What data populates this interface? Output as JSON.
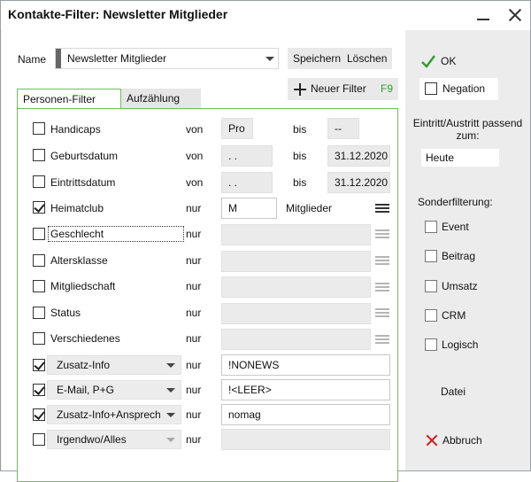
{
  "window": {
    "title": "Kontakte-Filter: Newsletter Mitglieder"
  },
  "header": {
    "name_label": "Name",
    "name_value": "Newsletter Mitglieder",
    "save_label": "Speichern",
    "delete_label": "Löschen",
    "new_filter_label": "Neuer Filter",
    "new_filter_shortcut": "F9"
  },
  "tabs": [
    {
      "label": "Personen-Filter",
      "active": true
    },
    {
      "label": "Aufzählung",
      "active": false
    }
  ],
  "rows": [
    {
      "label": "Handicaps",
      "checked": false,
      "op": "von",
      "from": "Pro",
      "to_label": "bis",
      "to": "--"
    },
    {
      "label": "Geburtsdatum",
      "checked": false,
      "op": "von",
      "from": " .  .",
      "to_label": "bis",
      "to": "31.12.2020"
    },
    {
      "label": "Eintrittsdatum",
      "checked": false,
      "op": "von",
      "from": " .  .",
      "to_label": "bis",
      "to": "31.12.2020"
    },
    {
      "label": "Heimatclub",
      "checked": true,
      "op": "nur",
      "value": "M",
      "suffix": "Mitglieder"
    },
    {
      "label": "Geschlecht",
      "checked": false,
      "op": "nur",
      "value": ""
    },
    {
      "label": "Altersklasse",
      "checked": false,
      "op": "nur",
      "value": ""
    },
    {
      "label": "Mitgliedschaft",
      "checked": false,
      "op": "nur",
      "value": ""
    },
    {
      "label": "Status",
      "checked": false,
      "op": "nur",
      "value": ""
    },
    {
      "label": "Verschiedenes",
      "checked": false,
      "op": "nur",
      "value": ""
    },
    {
      "label": "Zusatz-Info",
      "checked": true,
      "op": "nur",
      "value": "!NONEWS"
    },
    {
      "label": "E-Mail, P+G",
      "checked": true,
      "op": "nur",
      "value": "!<LEER>"
    },
    {
      "label": "Zusatz-Info+Ansprech",
      "checked": true,
      "op": "nur",
      "value": "nomag"
    },
    {
      "label": "Irgendwo/Alles",
      "checked": false,
      "op": "nur",
      "value": ""
    }
  ],
  "side": {
    "ok_label": "OK",
    "negation_label": "Negation",
    "entry_exit_label": "Eintritt/Austritt passend zum:",
    "entry_exit_value": "Heute",
    "special_label": "Sonderfilterung:",
    "special_items": [
      "Event",
      "Beitrag",
      "Umsatz",
      "CRM",
      "Logisch"
    ],
    "file_label": "Datei",
    "cancel_label": "Abbruch"
  },
  "colors": {
    "accent_green": "#2f9b2f",
    "cancel_red": "#d21b1b",
    "panel_border": "#6fbf5a"
  }
}
